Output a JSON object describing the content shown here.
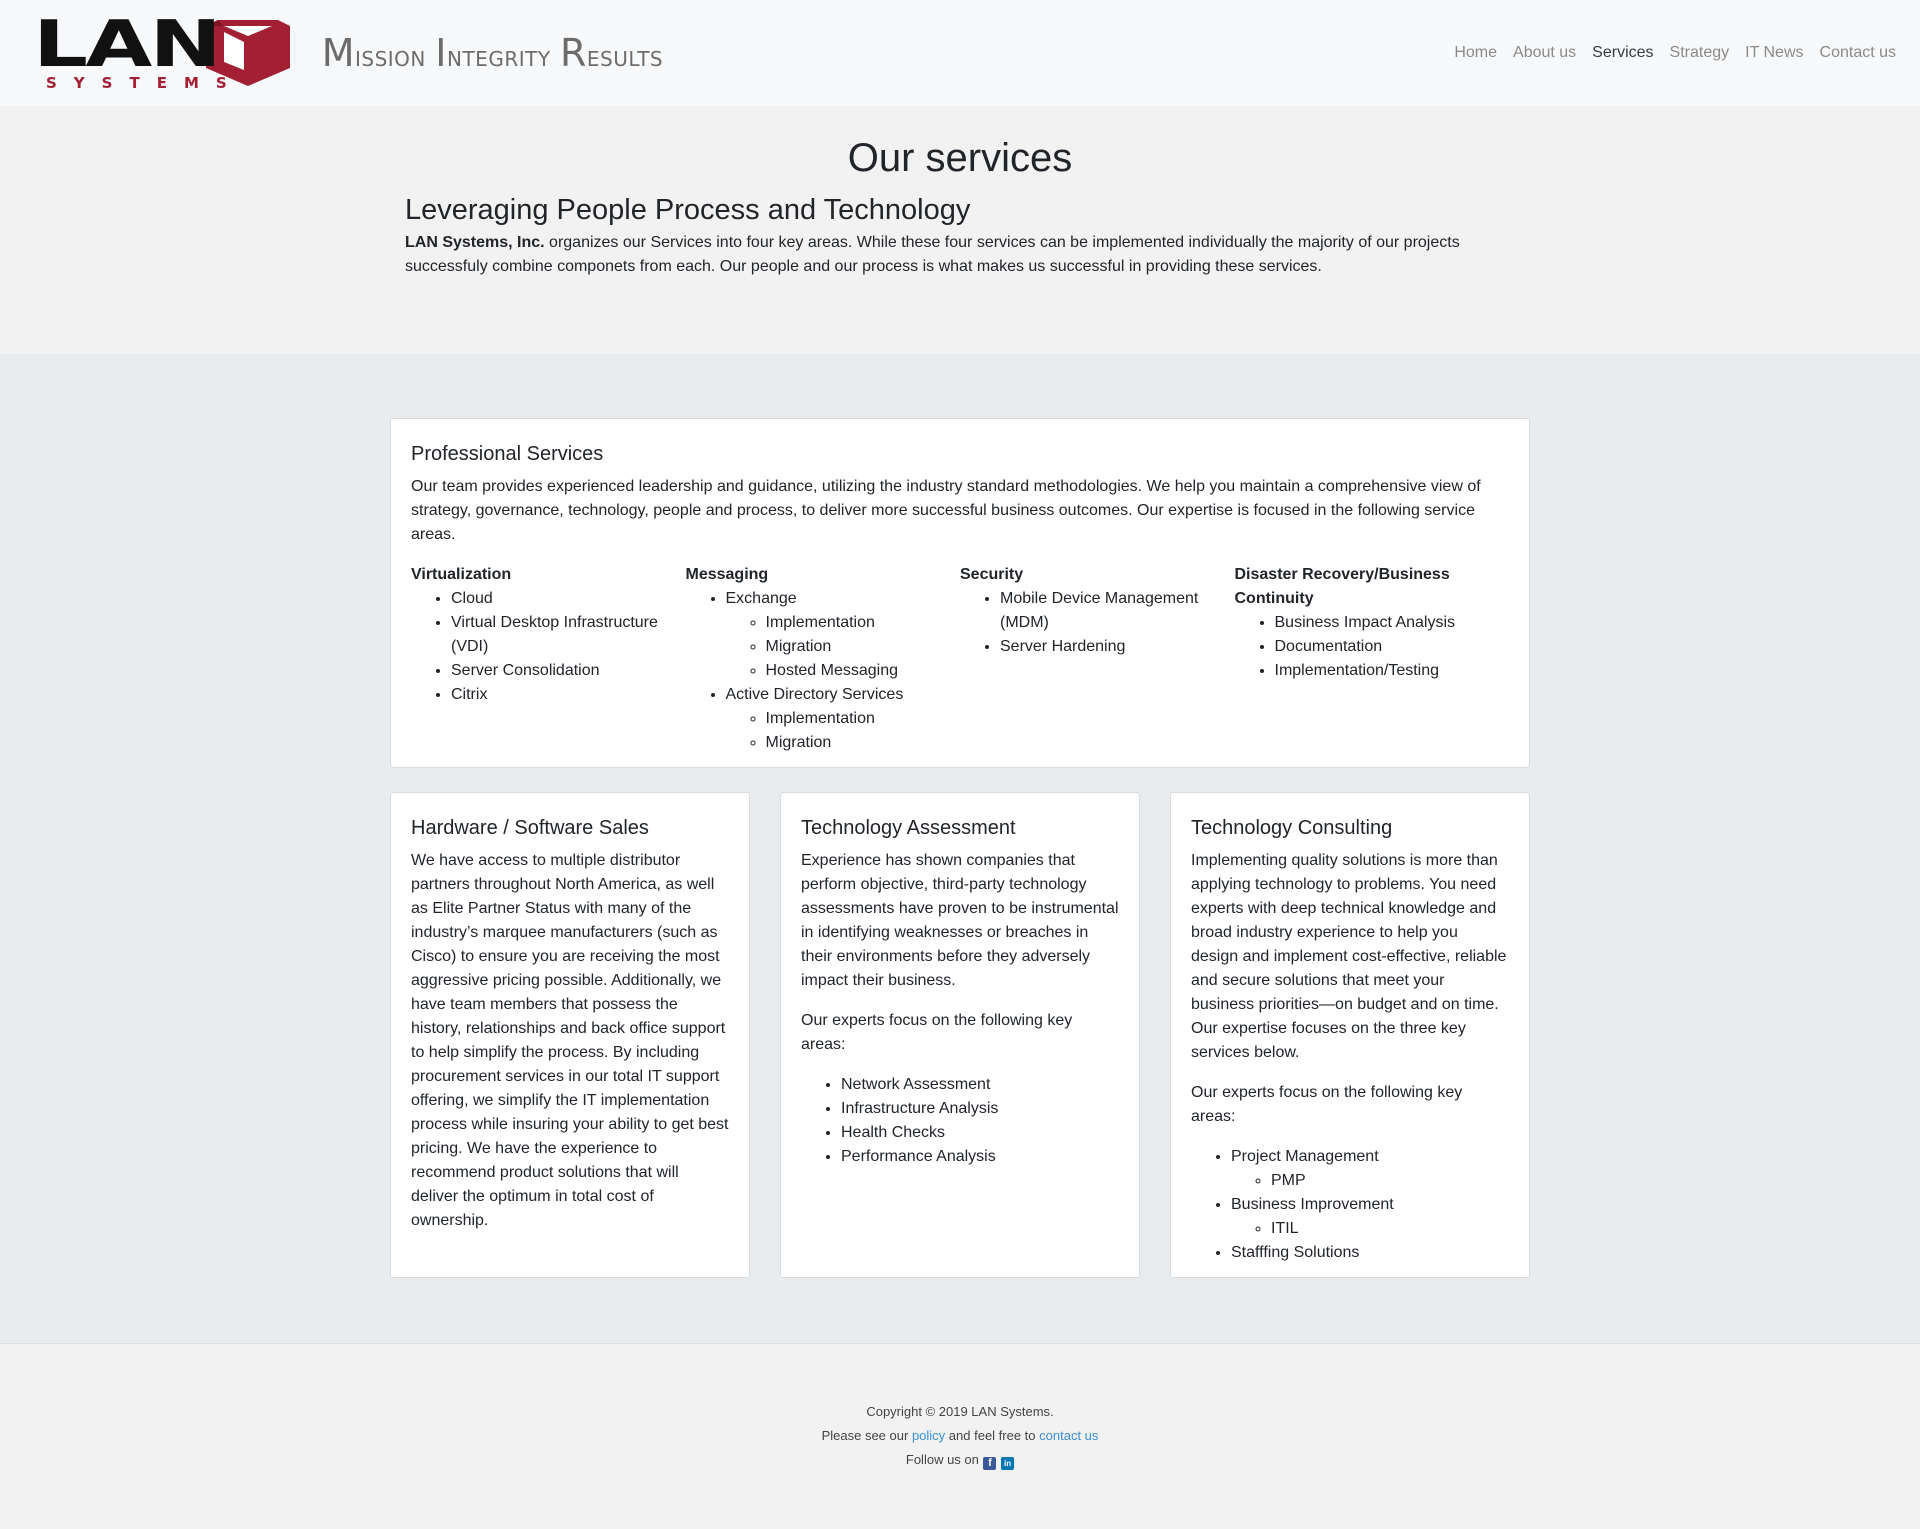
{
  "brand": {
    "logo_word": "LAN",
    "logo_sub": "SYSTEMS",
    "tagline_words": [
      {
        "cap": "M",
        "rest": "ission"
      },
      {
        "cap": "I",
        "rest": "ntegrity"
      },
      {
        "cap": "R",
        "rest": "esults"
      }
    ],
    "accent_color": "#a31f34"
  },
  "nav": {
    "items": [
      "Home",
      "About us",
      "Services",
      "Strategy",
      "IT News",
      "Contact us"
    ],
    "active": "Services"
  },
  "hero": {
    "title": "Our services",
    "subtitle": "Leveraging People Process and Technology",
    "company": "LAN Systems, Inc.",
    "body": " organizes our Services into four key areas. While these four services can be implemented individually the majority of our projects successfuly combine componets from each. Our people and our process is what makes us successful in providing these services."
  },
  "professional": {
    "title": "Professional Services",
    "body": "Our team provides experienced leadership and guidance, utilizing the industry standard methodologies. We help you maintain a comprehensive view of strategy, governance, technology, people and process, to deliver more successful business outcomes. Our expertise is focused in the following service areas.",
    "columns": [
      {
        "heading": "Virtualization",
        "items": [
          "Cloud",
          "Virtual Desktop Infrastructure (VDI)",
          "Server Consolidation",
          "Citrix"
        ]
      },
      {
        "heading": "Messaging",
        "items": [
          "Exchange",
          "Implementation",
          "Migration",
          "Hosted Messaging",
          "Active Directory Services",
          "Implementation",
          "Migration"
        ]
      },
      {
        "heading": "Security",
        "items": [
          "Mobile Device Management (MDM)",
          "Server Hardening"
        ]
      },
      {
        "heading": "Disaster Recovery/Business Continuity",
        "items": [
          "Business Impact Analysis",
          "Documentation",
          "Implementation/Testing"
        ]
      }
    ]
  },
  "hardware": {
    "title": "Hardware / Software Sales",
    "body": "We have access to multiple distributor partners throughout North America, as well as Elite Partner Status with many of the industry’s marquee manufacturers (such as Cisco) to ensure you are receiving the most aggressive pricing possible. Additionally, we have team members that possess the history, relationships and back office support to help simplify the process. By including procurement services in our total IT support offering, we simplify the IT implementation process while insuring your ability to get best pricing. We have the experience to recommend product solutions that will deliver the optimum in total cost of ownership."
  },
  "assessment": {
    "title": "Technology Assessment",
    "body": "Experience has shown companies that perform objective, third-party technology assessments have proven to be instrumental in identifying weaknesses or breaches in their environments before they adversely impact their business.",
    "focus": "Our experts focus on the following key areas:",
    "items": [
      "Network Assessment",
      "Infrastructure Analysis",
      "Health Checks",
      "Performance Analysis"
    ]
  },
  "consulting": {
    "title": "Technology Consulting",
    "body": "Implementing quality solutions is more than applying technology to problems. You need experts with deep technical knowledge and broad industry experience to help you design and implement cost-effective, reliable and secure solutions that meet your business priorities—on budget and on time. Our expertise focuses on the three key services below.",
    "focus": "Our experts focus on the following key areas:",
    "items": [
      "Project Management",
      "PMP",
      "Business Improvement",
      "ITIL",
      "Stafffing Solutions"
    ]
  },
  "footer": {
    "copyright": "Copyright © 2019 LAN Systems.",
    "see_prefix": "Please see our ",
    "policy": "policy",
    "middle": " and feel free to ",
    "contact": "contact us",
    "follow": "Follow us on ",
    "fb_glyph": "f",
    "li_glyph": "in"
  }
}
